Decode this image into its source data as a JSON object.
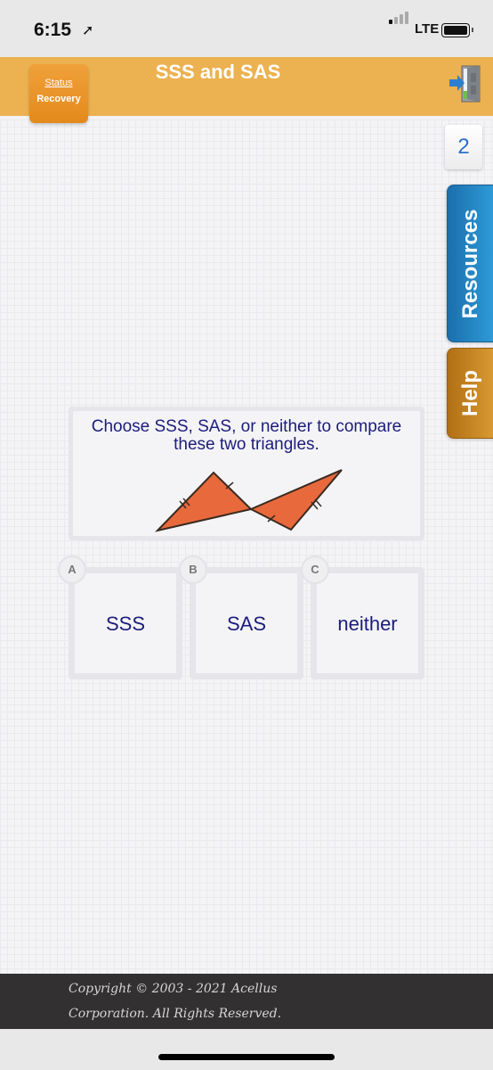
{
  "status_bar": {
    "time": "6:15",
    "network": "LTE",
    "signal_bars_active": 1,
    "signal_bars_total": 4
  },
  "header": {
    "title": "SSS and SAS",
    "status_button": {
      "line1": "Status",
      "line2": "Recovery"
    },
    "exit_icon": "exit-door-icon",
    "brand_color": "#ecb150"
  },
  "side": {
    "page_number": "2",
    "resources_label": "Resources",
    "help_label": "Help"
  },
  "question": {
    "text_line1": "Choose SSS, SAS, or neither to compare",
    "text_line2": "these two triangles.",
    "figure": "Two orange triangles meeting at a vertical-angle intersection with matching tick marks",
    "fill_color": "#e8693c"
  },
  "choices": [
    {
      "letter": "A",
      "label": "SSS"
    },
    {
      "letter": "B",
      "label": "SAS"
    },
    {
      "letter": "C",
      "label": "neither"
    }
  ],
  "footer": {
    "line1": "Copyright © 2003 - 2021 Acellus",
    "line2": "Corporation.  All Rights Reserved."
  }
}
